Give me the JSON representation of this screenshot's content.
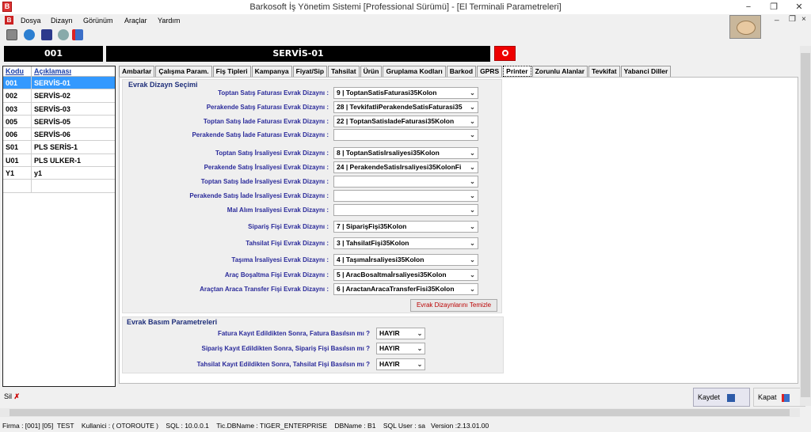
{
  "window": {
    "title": "Barkosoft İş Yönetim Sistemi [Professional Sürümü] - [El Terminali Parametreleri]",
    "minimize": "−",
    "restore": "❐",
    "close": "✕"
  },
  "menu": {
    "items": [
      "Dosya",
      "Dizayn",
      "Görünüm",
      "Araçlar",
      "Yardım"
    ],
    "mdi_min": "_",
    "mdi_restore": "❐",
    "mdi_close": "×"
  },
  "header": {
    "code": "001",
    "name": "SERVİS-01"
  },
  "list": {
    "columns": [
      "Kodu",
      "Açıklaması"
    ],
    "rows": [
      {
        "code": "001",
        "desc": "SERVİS-01",
        "selected": true
      },
      {
        "code": "002",
        "desc": "SERVİS-02"
      },
      {
        "code": "003",
        "desc": "SERVİS-03"
      },
      {
        "code": "005",
        "desc": "SERVİS-05"
      },
      {
        "code": "006",
        "desc": "SERVİS-06"
      },
      {
        "code": "S01",
        "desc": "PLS SERİS-1"
      },
      {
        "code": "U01",
        "desc": "PLS ULKER-1"
      },
      {
        "code": "Y1",
        "desc": "y1"
      },
      {
        "code": "",
        "desc": ""
      }
    ]
  },
  "tabs": [
    "Ambarlar",
    "Çalışma Param.",
    "Fiş Tipleri",
    "Kampanya",
    "Fiyat/Sip",
    "Tahsilat",
    "Ürün",
    "Gruplama Kodları",
    "Barkod",
    "GPRS",
    "Printer",
    "Zorunlu Alanlar",
    "Tevkifat",
    "Yabanci Diller"
  ],
  "active_tab": "Printer",
  "group1": {
    "title": "Evrak Dizayn Seçimi",
    "fields": [
      {
        "label": "Toptan Satış Faturası Evrak Dizaynı :",
        "value": "9 | ToptanSatisFaturasi35Kolon"
      },
      {
        "label": "Perakende Satış Faturası Evrak Dizaynı :",
        "value": "28 | TevkifatliPerakendeSatisFaturasi35"
      },
      {
        "label": "Toptan Satış İade Faturası Evrak Dizaynı :",
        "value": "22 | ToptanSatisIadeFaturasi35Kolon"
      },
      {
        "label": "Perakende Satış İade Faturası Evrak Dizaynı :",
        "value": ""
      },
      {
        "label": "Toptan Satış İrsaliyesi Evrak Dizaynı :",
        "value": "8 | ToptanSatisIrsaliyesi35Kolon"
      },
      {
        "label": "Perakende Satış İrsaliyesi Evrak Dizaynı :",
        "value": "24 | PerakendeSatisIrsaliyesi35KolonFi"
      },
      {
        "label": "Toptan Satış İade İrsaliyesi Evrak Dizaynı :",
        "value": ""
      },
      {
        "label": "Perakende Satış İade İrsaliyesi Evrak Dizaynı :",
        "value": ""
      },
      {
        "label": "Mal Alım Irsaliyesi Evrak Dizaynı :",
        "value": ""
      },
      {
        "label": "Sipariş Fişi Evrak Dizaynı :",
        "value": "7 | SiparişFişi35Kolon"
      },
      {
        "label": "Tahsilat Fişi Evrak Dizaynı :",
        "value": "3 | TahsilatFişi35Kolon"
      },
      {
        "label": "Taşıma İrsaliyesi Evrak Dizaynı :",
        "value": "4 | Taşımaİrsaliyesi35Kolon"
      },
      {
        "label": "Araç Boşaltma Fişi Evrak Dizaynı :",
        "value": "5 | AracBosaltmaİrsaliyesi35Kolon"
      },
      {
        "label": "Araçtan Araca Transfer Fişi Evrak Dizaynı :",
        "value": "6 | AractanAracaTransferFisi35Kolon"
      }
    ],
    "clear_button": "Evrak Dizaynlarını Temizle"
  },
  "group2": {
    "title": "Evrak Basım Parametreleri",
    "fields": [
      {
        "label": "Fatura Kayıt Edildikten Sonra, Fatura Basılsın mı ?",
        "value": "HAYIR"
      },
      {
        "label": "Sipariş Kayıt Edildikten Sonra, Sipariş Fişi Basılsın mı ?",
        "value": "HAYIR"
      },
      {
        "label": "Tahsilat  Kayıt Edildikten Sonra, Tahsilat Fişi Basılsın mı ?",
        "value": "HAYIR"
      }
    ]
  },
  "buttons": {
    "delete": "Sil",
    "save": "Kaydet",
    "close": "Kapat"
  },
  "status": "Firma : [001] [05]  TEST    Kullanici : ( OTOROUTE )    SQL : 10.0.0.1    Tic.DBName : TIGER_ENTERPRISE    DBName : B1    SQL User : sa   Version :2.13.01.00",
  "icons": [
    "app-logo-icon",
    "user-icon",
    "globe-icon",
    "report-icon",
    "settings-icon",
    "exit-icon",
    "search-icon",
    "delete-icon",
    "save-icon",
    "close-door-icon"
  ],
  "colors": {
    "selection": "#3399ff",
    "label_blue": "#2a2a9a",
    "clear_button_text": "#bb0000"
  }
}
